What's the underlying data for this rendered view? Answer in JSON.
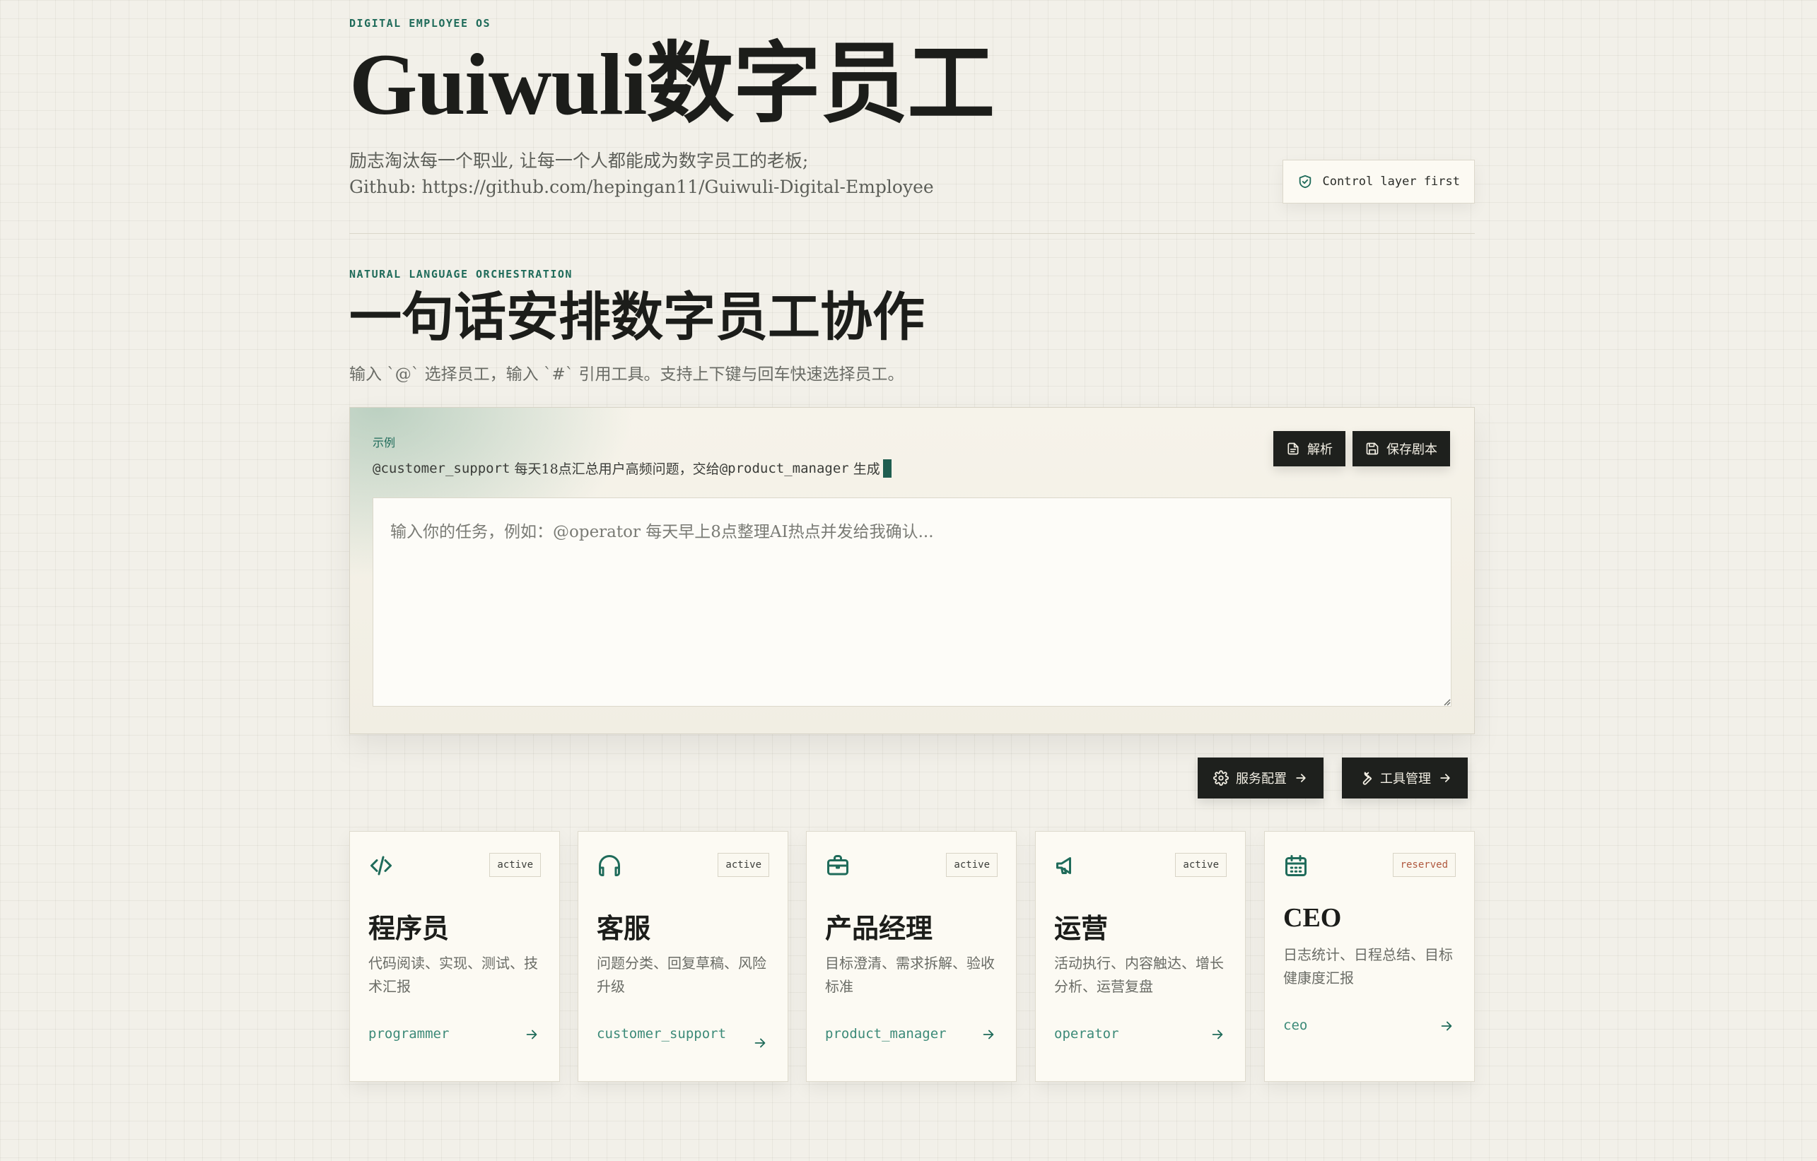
{
  "hero": {
    "eyebrow": "DIGITAL EMPLOYEE OS",
    "title": "Guiwuli数字员工",
    "tagline": "励志淘汰每一个职业, 让每一个人都能成为数字员工的老板;",
    "github": "Github: https://github.com/hepingan11/Guiwuli-Digital-Employee",
    "badge": "Control layer first"
  },
  "orchestration": {
    "eyebrow": "NATURAL LANGUAGE ORCHESTRATION",
    "title": "一句话安排数字员工协作",
    "subtitle": "输入 `@` 选择员工，输入 `#` 引用工具。支持上下键与回车快速选择员工。",
    "example_label": "示例",
    "example_mention_1": "@customer_support",
    "example_middle": " 每天18点汇总用户高频问题，交给",
    "example_mention_2": "@product_manager",
    "example_end": " 生成",
    "parse_label": "解析",
    "save_label": "保存剧本",
    "input_placeholder": "输入你的任务，例如：@operator 每天早上8点整理AI热点并发给我确认...",
    "input_value": ""
  },
  "actions": {
    "service_config": "服务配置",
    "tool_manage": "工具管理"
  },
  "colors": {
    "accent": "#1f6b5a",
    "dark": "#1e201d",
    "reserved": "#b0593f"
  },
  "employees": [
    {
      "icon": "code-icon",
      "status": "active",
      "title": "程序员",
      "desc": "代码阅读、实现、测试、技术汇报",
      "slug": "programmer"
    },
    {
      "icon": "headphones-icon",
      "status": "active",
      "title": "客服",
      "desc": "问题分类、回复草稿、风险升级",
      "slug": "customer_support"
    },
    {
      "icon": "briefcase-icon",
      "status": "active",
      "title": "产品经理",
      "desc": "目标澄清、需求拆解、验收标准",
      "slug": "product_manager"
    },
    {
      "icon": "megaphone-icon",
      "status": "active",
      "title": "运营",
      "desc": "活动执行、内容触达、增长分析、运营复盘",
      "slug": "operator"
    },
    {
      "icon": "calendar-icon",
      "status": "reserved",
      "title": "CEO",
      "desc": "日志统计、日程总结、目标健康度汇报",
      "slug": "ceo"
    }
  ]
}
